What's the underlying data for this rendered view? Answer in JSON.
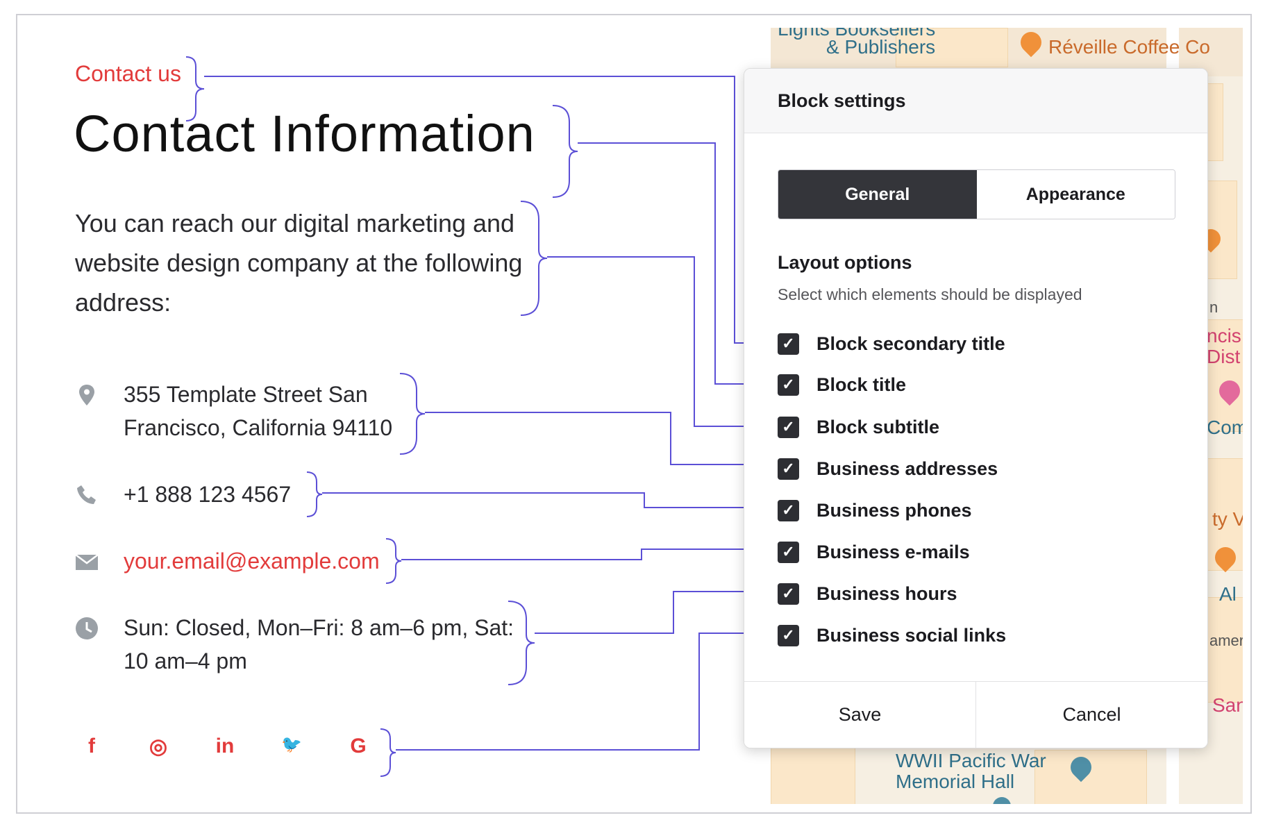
{
  "content": {
    "secondary_title": "Contact us",
    "title": "Contact Information",
    "subtitle_lines": [
      "You can reach our digital marketing and",
      "website design company at the following",
      "address:"
    ],
    "address_lines": [
      "355 Template Street San",
      "Francisco, California 94110"
    ],
    "phone": "+1 888 123 4567",
    "email": "your.email@example.com",
    "hours_lines": [
      "Sun: Closed, Mon–Fri: 8 am–6 pm, Sat:",
      "10 am–4 pm"
    ],
    "social": [
      {
        "icon": "facebook-icon",
        "glyph": "f"
      },
      {
        "icon": "instagram-icon",
        "glyph": "◎"
      },
      {
        "icon": "linkedin-icon",
        "glyph": "in"
      },
      {
        "icon": "twitter-icon",
        "glyph": "🐦"
      },
      {
        "icon": "google-icon",
        "glyph": "G"
      }
    ],
    "icons": {
      "address": "map-pin-icon",
      "phone": "phone-icon",
      "email": "envelope-icon",
      "hours": "clock-icon"
    }
  },
  "map": {
    "labels": {
      "bookseller_1": "Lights Booksellers",
      "bookseller_2": "& Publishers",
      "coffee": "Réveille Coffee Co",
      "memorial_1": "WWII Pacific War",
      "memorial_2": "Memorial Hall",
      "edge_1": "ncis",
      "edge_2": "Dist",
      "edge_3": "Com",
      "edge_4": "ty V",
      "edge_5": "Al",
      "edge_6": "amer",
      "edge_7": "San",
      "edge_8": "n"
    }
  },
  "dialog": {
    "title": "Block settings",
    "tabs": [
      {
        "label": "General",
        "active": true
      },
      {
        "label": "Appearance",
        "active": false
      }
    ],
    "layout_title": "Layout options",
    "layout_desc": "Select which elements should be displayed",
    "options": [
      {
        "label": "Block secondary title",
        "checked": true
      },
      {
        "label": "Block title",
        "checked": true
      },
      {
        "label": "Block subtitle",
        "checked": true
      },
      {
        "label": "Business addresses",
        "checked": true
      },
      {
        "label": "Business phones",
        "checked": true
      },
      {
        "label": "Business e-mails",
        "checked": true
      },
      {
        "label": "Business hours",
        "checked": true
      },
      {
        "label": "Business social links",
        "checked": true
      }
    ],
    "save_label": "Save",
    "cancel_label": "Cancel"
  },
  "colors": {
    "accent_red": "#e23b3b",
    "connector": "#5b4fd6",
    "dark": "#34353a"
  }
}
